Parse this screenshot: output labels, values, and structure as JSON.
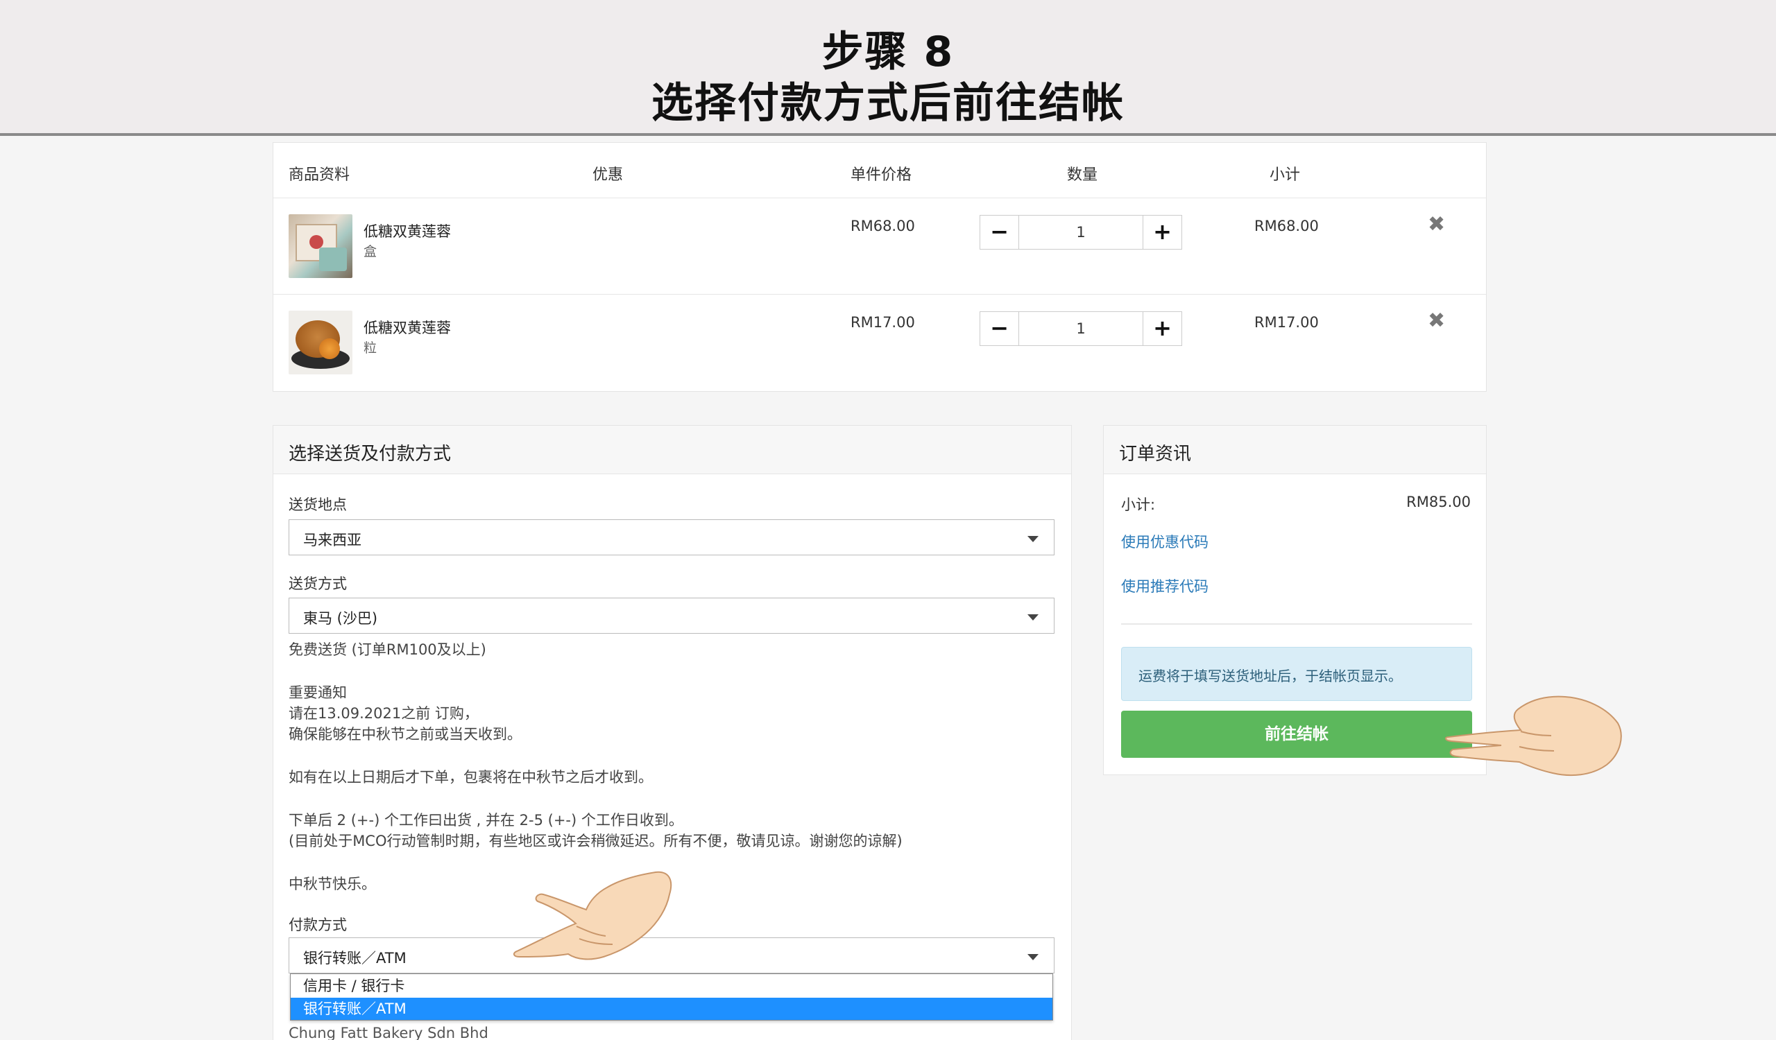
{
  "banner": {
    "step": "步骤 8",
    "subtitle": "选择付款方式后前往结帐"
  },
  "cart": {
    "headers": {
      "product": "商品资料",
      "discount": "优惠",
      "unit_price": "单件价格",
      "quantity": "数量",
      "subtotal": "小计"
    },
    "items": [
      {
        "name": "低糖双黄莲蓉",
        "variant": "盒",
        "price": "RM68.00",
        "qty": "1",
        "subtotal": "RM68.00"
      },
      {
        "name": "低糖双黄莲蓉",
        "variant": "粒",
        "price": "RM17.00",
        "qty": "1",
        "subtotal": "RM17.00"
      }
    ],
    "qty_minus": "−",
    "qty_plus": "+",
    "remove": "✖"
  },
  "shipping": {
    "title": "选择送货及付款方式",
    "location_label": "送货地点",
    "location_value": "马来西亚",
    "method_label": "送货方式",
    "method_value": "東马 (沙巴)",
    "free_shipping": "免费送货 (订单RM100及以上)",
    "notice_title": "重要通知",
    "notice_line1": "请在13.09.2021之前 订购，",
    "notice_line2": "确保能够在中秋节之前或当天收到。",
    "notice_line3": "如有在以上日期后才下单，包裹将在中秋节之后才收到。",
    "notice_line4": "下单后 2 (+-) 个工作曰出货 , 并在 2-5 (+-) 个工作日收到。",
    "notice_line5": "(目前处于MCO行动管制时期，有些地区或许会稍微延迟。所有不便，敬请见谅。谢谢您的谅解)",
    "greeting": "中秋节快乐。",
    "payment_label": "付款方式",
    "payment_value": "银行转账／ATM",
    "payment_options": [
      "信用卡 / 银行卡",
      "银行转账／ATM"
    ],
    "company": "Chung Fatt Bakery Sdn Bhd"
  },
  "order": {
    "title": "订单资讯",
    "subtotal_label": "小计:",
    "subtotal_value": "RM85.00",
    "coupon_link": "使用优惠代码",
    "referral_link": "使用推荐代码",
    "notice": "运费将于填写送货地址后，于结帐页显示。",
    "checkout_label": "前往结帐"
  },
  "colors": {
    "checkout_green": "#5cb85c",
    "link_blue": "#2a7ab8",
    "selected_option": "#1e90ff",
    "notice_bg": "#d9edf7"
  }
}
